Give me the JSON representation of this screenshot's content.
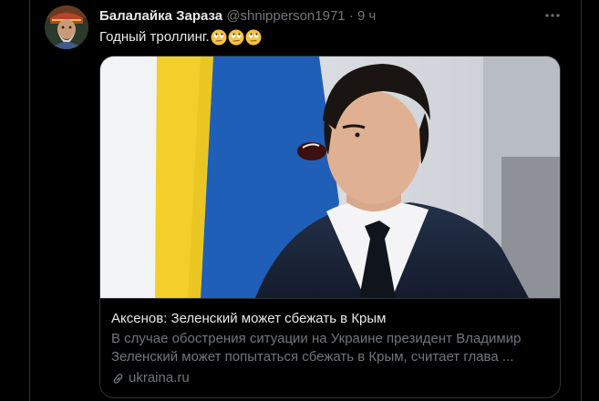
{
  "tweet": {
    "author_name": "Балалайка Зараза",
    "author_handle": "@shnipperson1971",
    "separator": "·",
    "time": "9 ч",
    "text": "Годный троллинг.",
    "emojis": [
      "face-with-rolling-eyes",
      "face-with-rolling-eyes",
      "face-with-rolling-eyes"
    ]
  },
  "card": {
    "title": "Аксенов: Зеленский может сбежать в Крым",
    "description": "В случае обострения ситуации на Украине президент Владимир Зеленский может попытаться сбежать в Крым, считает глава ...",
    "domain": "ukraina.ru"
  },
  "icons": {
    "more": "more-horizontal-icon",
    "link": "link-icon"
  },
  "colors": {
    "background": "#000000",
    "text_primary": "#e7e9ea",
    "text_secondary": "#71767b",
    "border": "#2f3336",
    "flag_blue": "#1f5fb8",
    "flag_yellow": "#f2cf2a"
  }
}
